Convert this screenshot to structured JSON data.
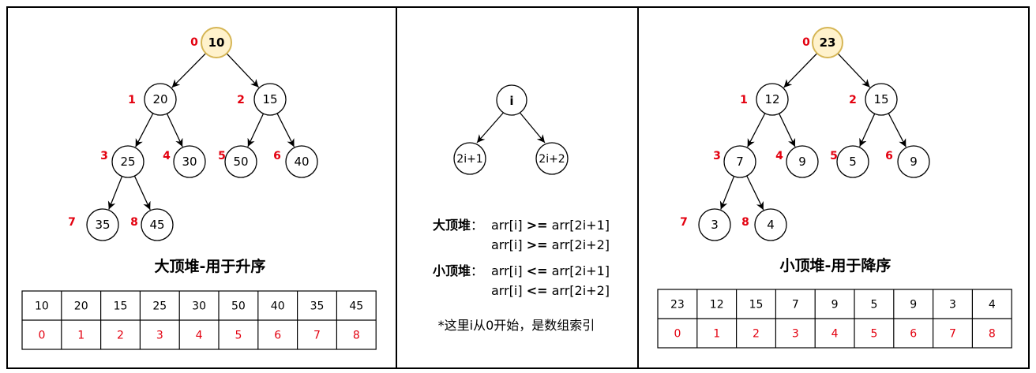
{
  "left": {
    "title": "大顶堆-用于升序",
    "nodes": [
      {
        "index": "0",
        "value": "10",
        "highlight": true
      },
      {
        "index": "1",
        "value": "20"
      },
      {
        "index": "2",
        "value": "15"
      },
      {
        "index": "3",
        "value": "25"
      },
      {
        "index": "4",
        "value": "30"
      },
      {
        "index": "5",
        "value": "50"
      },
      {
        "index": "6",
        "value": "40"
      },
      {
        "index": "7",
        "value": "35"
      },
      {
        "index": "8",
        "value": "45"
      }
    ],
    "array_values": [
      "10",
      "20",
      "15",
      "25",
      "30",
      "50",
      "40",
      "35",
      "45"
    ],
    "array_indices": [
      "0",
      "1",
      "2",
      "3",
      "4",
      "5",
      "6",
      "7",
      "8"
    ]
  },
  "middle": {
    "parent": "i",
    "left_child": "2i+1",
    "right_child": "2i+2",
    "max_heap_label": "大顶堆",
    "max_heap_rule1": {
      "a": "arr[i]",
      "op": ">=",
      "b": "arr[2i+1]"
    },
    "max_heap_rule2": {
      "a": "arr[i]",
      "op": ">=",
      "b": "arr[2i+2]"
    },
    "min_heap_label": "小顶堆",
    "min_heap_rule1": {
      "a": "arr[i]",
      "op": "<=",
      "b": "arr[2i+1]"
    },
    "min_heap_rule2": {
      "a": "arr[i]",
      "op": "<=",
      "b": "arr[2i+2]"
    },
    "colon": "：",
    "note": "*这里i从0开始，是数组索引"
  },
  "right": {
    "title": "小顶堆-用于降序",
    "nodes": [
      {
        "index": "0",
        "value": "23",
        "highlight": true
      },
      {
        "index": "1",
        "value": "12"
      },
      {
        "index": "2",
        "value": "15"
      },
      {
        "index": "3",
        "value": "7"
      },
      {
        "index": "4",
        "value": "9"
      },
      {
        "index": "5",
        "value": "5"
      },
      {
        "index": "6",
        "value": "9"
      },
      {
        "index": "7",
        "value": "3"
      },
      {
        "index": "8",
        "value": "4"
      }
    ],
    "array_values": [
      "23",
      "12",
      "15",
      "7",
      "9",
      "5",
      "9",
      "3",
      "4"
    ],
    "array_indices": [
      "0",
      "1",
      "2",
      "3",
      "4",
      "5",
      "6",
      "7",
      "8"
    ]
  },
  "colors": {
    "index_red": "#e3000f",
    "highlight_fill": "#fff2cc",
    "highlight_stroke": "#d6b656",
    "line": "#000000"
  }
}
